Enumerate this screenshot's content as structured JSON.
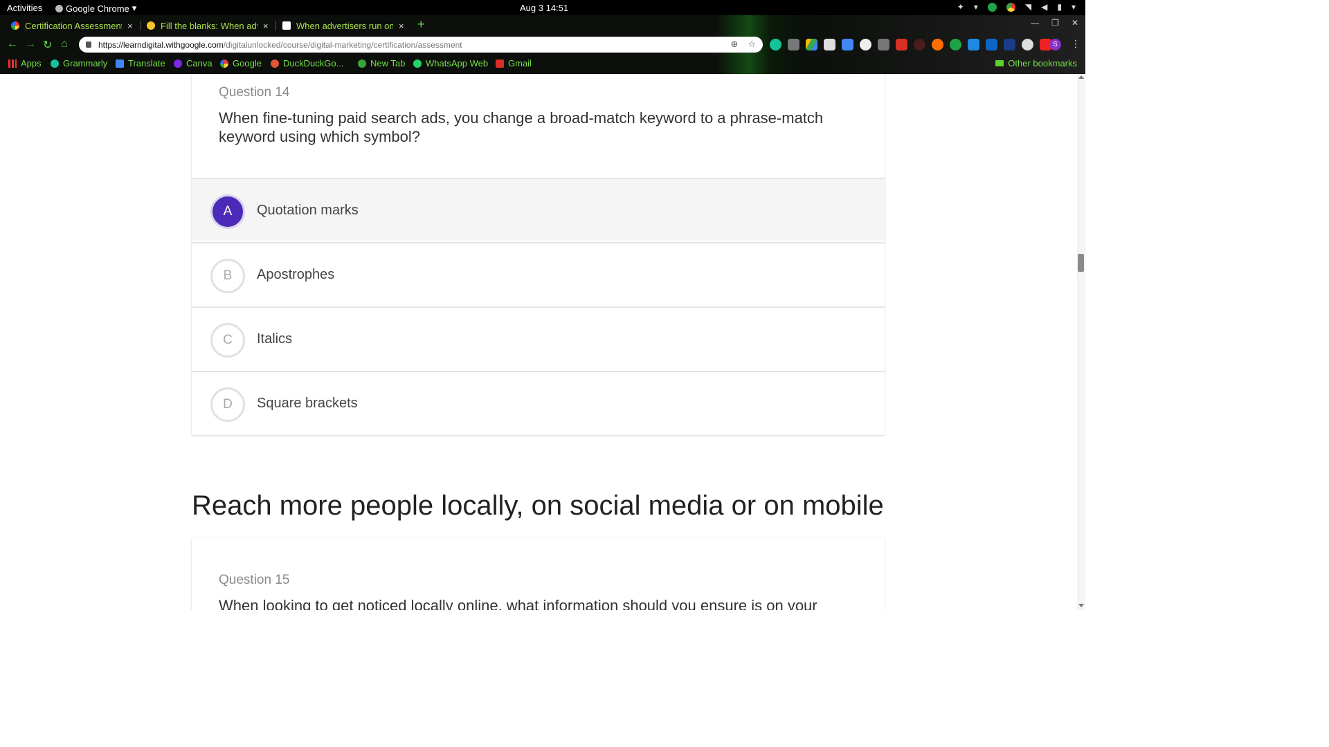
{
  "system": {
    "activities": "Activities",
    "app_name": "Google Chrome",
    "clock": "Aug 3  14:51"
  },
  "browser": {
    "tabs": [
      {
        "title": "Certification Assessment",
        "active": true
      },
      {
        "title": "Fill the blanks: When adv",
        "active": false
      },
      {
        "title": "When advertisers run onl",
        "active": false
      }
    ],
    "close_glyph": "×",
    "new_tab_glyph": "+",
    "url_host": "https://learndigital.withgoogle.com",
    "url_path": "/digitalunlocked/course/digital-marketing/certification/assessment",
    "profile_initial": "S",
    "bookmarks": [
      {
        "label": "Apps"
      },
      {
        "label": "Grammarly"
      },
      {
        "label": "Translate"
      },
      {
        "label": "Canva"
      },
      {
        "label": "Google"
      },
      {
        "label": "DuckDuckGo..."
      },
      {
        "label": "New Tab"
      },
      {
        "label": "WhatsApp Web"
      },
      {
        "label": "Gmail"
      }
    ],
    "other_bookmarks": "Other bookmarks"
  },
  "page": {
    "question_14": {
      "number": "Question 14",
      "text": "When fine-tuning paid search ads, you change a broad-match keyword to a phrase-match keyword using which symbol?",
      "options": [
        {
          "letter": "A",
          "text": "Quotation marks",
          "selected": true
        },
        {
          "letter": "B",
          "text": "Apostrophes",
          "selected": false
        },
        {
          "letter": "C",
          "text": "Italics",
          "selected": false
        },
        {
          "letter": "D",
          "text": "Square brackets",
          "selected": false
        }
      ]
    },
    "section_heading": "Reach more people locally, on social media or on mobile",
    "question_15": {
      "number": "Question 15",
      "text": "When looking to get noticed locally online, what information should you ensure is on your"
    }
  },
  "colors": {
    "accent_selected": "#4b2ab8",
    "bookmark_text": "#77e04a",
    "tab_text": "#a8e04a"
  }
}
